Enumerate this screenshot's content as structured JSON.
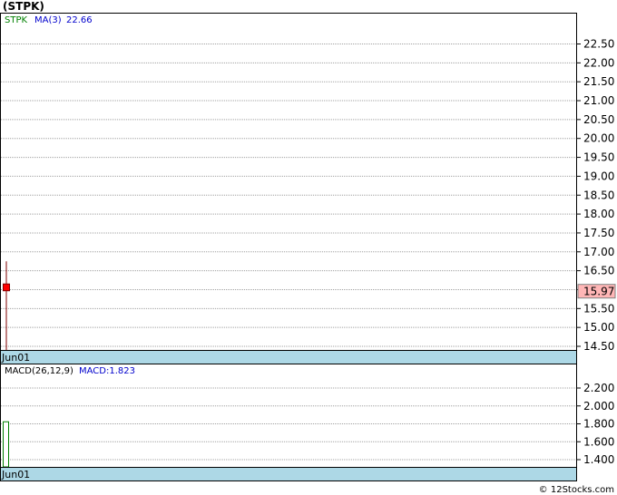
{
  "title": "(STPK)",
  "footer": "© 12Stocks.com",
  "colors": {
    "ticker": "#008000",
    "ma": "#0000cc",
    "macd": "#0000cc",
    "candle_down": "#ff0000",
    "wick": "#800000",
    "macd_bar": "#008000",
    "date_band": "#add8e6",
    "last_price_box": "#ffb6b6"
  },
  "chart_data": [
    {
      "type": "candlestick",
      "legend": {
        "ticker": "STPK",
        "ma_label": "MA(3)",
        "ma_value": "22.66"
      },
      "y_ticks": [
        "22.50",
        "22.00",
        "21.50",
        "21.00",
        "20.50",
        "20.00",
        "19.50",
        "19.00",
        "18.50",
        "18.00",
        "17.50",
        "17.00",
        "16.50",
        "16.00",
        "15.50",
        "15.00",
        "14.50"
      ],
      "y_tick_values": [
        22.5,
        22.0,
        21.5,
        21.0,
        20.5,
        20.0,
        19.5,
        19.0,
        18.5,
        18.0,
        17.5,
        17.0,
        16.5,
        16.0,
        15.5,
        15.0,
        14.5
      ],
      "x_labels": [
        "Jun01"
      ],
      "candles": [
        {
          "date": "Jun01",
          "open": 16.15,
          "high": 16.75,
          "low": 14.35,
          "close": 15.97
        }
      ],
      "last_price": "15.97",
      "last_price_value": 15.97
    },
    {
      "type": "bar",
      "legend": {
        "label": "MACD(26,12,9)",
        "value_label": "MACD:1.823"
      },
      "y_ticks": [
        "2.200",
        "2.000",
        "1.800",
        "1.600",
        "1.400"
      ],
      "y_tick_values": [
        2.2,
        2.0,
        1.8,
        1.6,
        1.4
      ],
      "x_labels": [
        "Jun01"
      ],
      "bars": [
        {
          "date": "Jun01",
          "value": 1.823
        }
      ]
    }
  ]
}
